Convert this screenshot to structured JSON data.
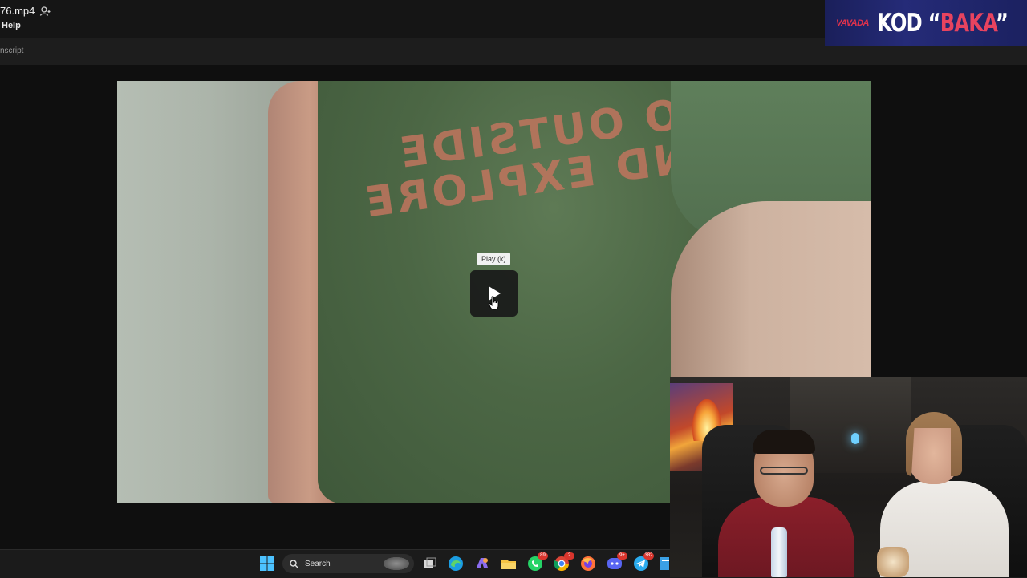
{
  "window": {
    "file_title": "76.mp4",
    "menu_help": "Help",
    "toolbar_transcript": "nscript"
  },
  "video": {
    "tooltip": "Play (k)",
    "shirt_print_line1": "GO OUTSIDE",
    "shirt_print_line2": "AND EXPLORE"
  },
  "taskbar": {
    "search_label": "Search",
    "whatsapp_badge": "89",
    "chrome_badge": "2",
    "discord_badge": "9+",
    "telegram_badge": "382"
  },
  "overlay": {
    "sponsor_brand": "VAVADA",
    "sponsor_kod": "KOD “",
    "sponsor_code": "BAKA",
    "sponsor_close_quote": "”"
  },
  "colors": {
    "sponsor_background": "#252b78",
    "sponsor_accent": "#e8435f",
    "taskbar_background": "#1b1b1b"
  }
}
